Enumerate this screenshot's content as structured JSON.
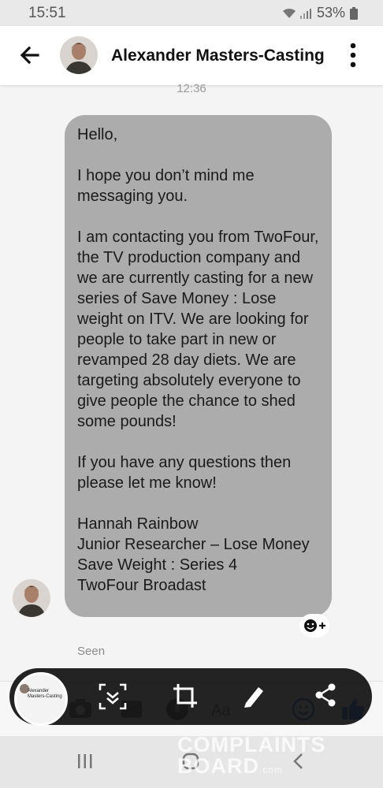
{
  "status": {
    "time": "15:51",
    "battery": "53%"
  },
  "header": {
    "contact_name": "Alexander Masters-Casting"
  },
  "conversation": {
    "timestamp": "12:36",
    "message_paragraphs": [
      "Hello,",
      "I hope you don’t mind me messaging you.",
      "I am contacting you from TwoFour, the TV production company and we are currently casting for a new series of Save Money : Lose weight on ITV. We are looking for people to take part in new or revamped 28 day diets. We are  targeting absolutely everyone to give people the chance to shed some pounds!",
      "If you have any questions then please let me know!",
      "Hannah Rainbow\nJunior Researcher – Lose Money Save Weight : Series 4\nTwoFour Broadast"
    ],
    "seen_label": "Seen"
  },
  "composer": {
    "placeholder": "Aa"
  },
  "capture_preview": {
    "name": "Alexander Masters-Casting"
  },
  "watermark": {
    "text": "COMPLAINTS BOARD",
    "domain": ".com"
  },
  "colors": {
    "bubble": "#acacac",
    "like_blue": "#1877f2",
    "capture_bar": "#121212"
  }
}
